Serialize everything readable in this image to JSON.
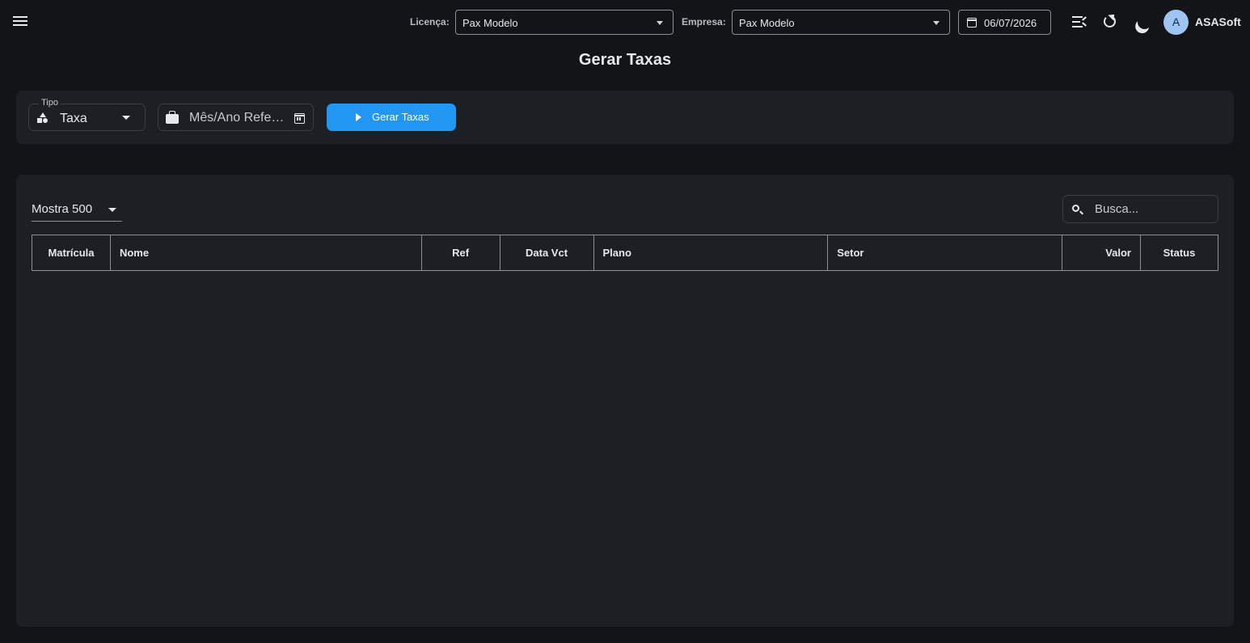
{
  "topbar": {
    "licenca_label": "Licença:",
    "licenca_value": "Pax Modelo",
    "empresa_label": "Empresa:",
    "empresa_value": "Pax Modelo",
    "date_value": "06/07/2026",
    "avatar_initial": "A",
    "username": "ASASoft"
  },
  "page": {
    "title": "Gerar Taxas"
  },
  "filters": {
    "tipo_label": "Tipo",
    "tipo_value": "Taxa",
    "ref_placeholder": "Mês/Ano Referência",
    "generate_label": "Gerar Taxas"
  },
  "table": {
    "page_size_label": "Mostra 500",
    "search_placeholder": "Busca...",
    "columns": [
      "Matrícula",
      "Nome",
      "Ref",
      "Data Vct",
      "Plano",
      "Setor",
      "Valor",
      "Status"
    ],
    "rows": []
  },
  "colors": {
    "background": "#121418",
    "card": "#1c1f24",
    "accent": "#2196f3",
    "avatar": "#9ec5f2"
  },
  "icons": [
    "menu-icon",
    "calendar-icon",
    "menu-open-icon",
    "refresh-icon",
    "dark-mode-icon",
    "shapes-icon",
    "briefcase-icon",
    "calendar-month-icon",
    "play-icon",
    "search-icon",
    "chevron-down-icon"
  ]
}
